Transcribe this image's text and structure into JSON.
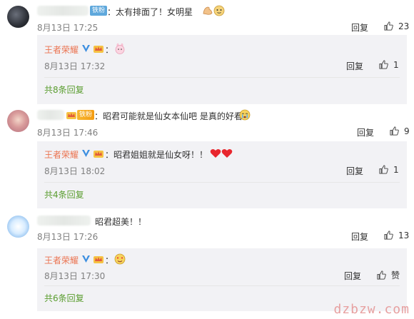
{
  "comments": [
    {
      "fan_badge": "铁粉",
      "text": "：太有排面了！女明星",
      "time": "8月13日 17:25",
      "reply_label": "回复",
      "like_count": "23",
      "reply": {
        "author": "王者荣耀",
        "text": "：",
        "time": "8月13日 17:32",
        "reply_label": "回复",
        "like_count": "1"
      },
      "more_replies": "共8条回复"
    },
    {
      "fan_badge": "铁粉",
      "text": "：昭君可能就是仙女本仙吧 是真的好看",
      "time": "8月13日 17:46",
      "reply_label": "回复",
      "like_count": "9",
      "reply": {
        "author": "王者荣耀",
        "text": "：昭君姐姐就是仙女呀！！",
        "time": "8月13日 18:02",
        "reply_label": "回复",
        "like_count": "1"
      },
      "more_replies": "共4条回复"
    },
    {
      "text": "昭君超美！！",
      "time": "8月13日 17:26",
      "reply_label": "回复",
      "like_count": "13",
      "reply": {
        "author": "王者荣耀",
        "text": "：",
        "time": "8月13日 17:30",
        "reply_label": "回复",
        "like_count": "赞"
      },
      "more_replies": "共6条回复"
    }
  ],
  "watermark": "dzbzw.com",
  "colors": {
    "author_name": "#eb7350",
    "more_link": "#5a9d2f",
    "reply_bg": "#f2f2f5",
    "meta_text": "#808080",
    "verified_badge": "#3d8fe0"
  },
  "icons": {
    "like": "thumbs-up-icon",
    "verified": "verified-v-icon",
    "crown": "crown-badge-icon",
    "hearts": "red-heart-icon"
  }
}
